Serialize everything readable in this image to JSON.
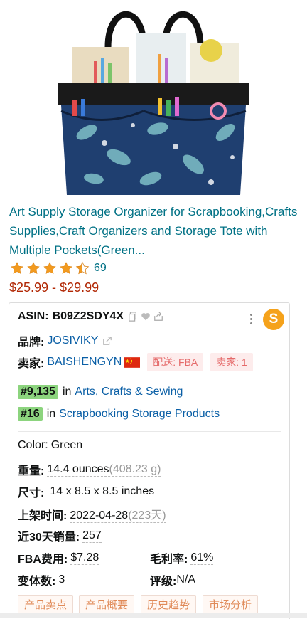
{
  "product": {
    "title": "Art Supply Storage Organizer for Scrapbooking,Crafts Supplies,Craft Organizers and Storage Tote with Multiple Pockets(Green...",
    "rating": 4.5,
    "rating_count": "69",
    "price": "$25.99 - $29.99"
  },
  "panel": {
    "asin_label": "ASIN:",
    "asin_value": "B09Z2SDY4X",
    "brand_label": "品牌:",
    "brand_value": "JOSIVIKY",
    "seller_label": "卖家:",
    "seller_value": "BAISHENGYN",
    "delivery_tag": "配送: FBA",
    "seller_count_tag": "卖家: 1",
    "rank1_badge": "#9,135",
    "rank1_in": "in",
    "rank1_category": "Arts, Crafts & Sewing",
    "rank2_badge": "#16",
    "rank2_in": "in",
    "rank2_category": "Scrapbooking Storage Products",
    "color_label": "Color:",
    "color_value": "Green",
    "weight_label": "重量:",
    "weight_value": "14.4 ounces",
    "weight_grams": "(408.23 g)",
    "size_label": "尺寸:",
    "size_value": "14 x 8.5 x 8.5 inches",
    "listed_label": "上架时间:",
    "listed_value": "2022-04-28",
    "listed_days": "(223天)",
    "sales_label": "近30天销量:",
    "sales_value": "257",
    "fba_label": "FBA费用:",
    "fba_value": "$7.28",
    "margin_label": "毛利率:",
    "margin_value": "61%",
    "variants_label": "变体数:",
    "variants_value": "3",
    "grade_label": "评级:",
    "grade_value": "N/A",
    "logo_letter": "S",
    "buttons": [
      "产品卖点",
      "产品概要",
      "历史趋势",
      "市场分析"
    ]
  },
  "colors": {
    "link": "#007185",
    "price": "#b12704",
    "rank_badge": "#8cd47e",
    "tag_bg": "#fdecec",
    "logo": "#f5a21b"
  },
  "icons": [
    "copy-icon",
    "heart-icon",
    "share-icon",
    "external-link-icon",
    "china-flag-icon",
    "star-icon",
    "half-star-icon"
  ]
}
